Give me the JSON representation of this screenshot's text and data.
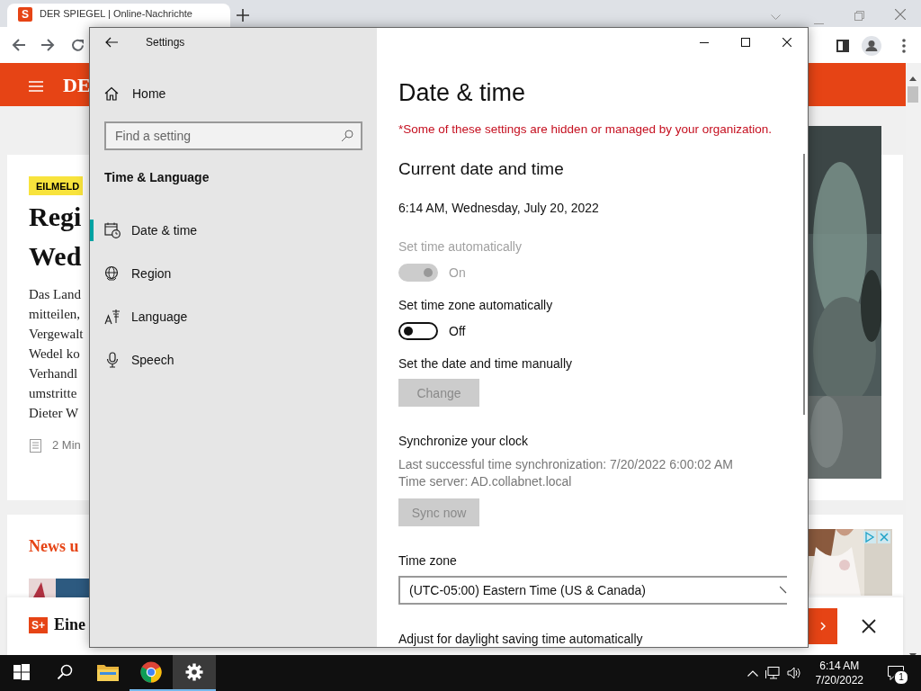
{
  "browser": {
    "tab": {
      "icon_text": "S",
      "title": "DER SPIEGEL | Online-Nachrichte"
    },
    "logo": "DE",
    "article": {
      "badge": "EILMELD",
      "headline": [
        "Regi",
        "Wed"
      ],
      "body": [
        "Das Land",
        "mitteilen,",
        "Vergewalt",
        "Wedel ko",
        "Verhandl",
        "umstritte",
        "Dieter W"
      ],
      "read_time": "2 Min"
    },
    "section_title": "News u",
    "banner": {
      "badge": "S+",
      "text": "Eine"
    }
  },
  "settings": {
    "title": "Settings",
    "home": "Home",
    "search": {
      "placeholder": "Find a setting"
    },
    "category": "Time & Language",
    "nav_items": [
      {
        "label": "Date & time",
        "selected": true
      },
      {
        "label": "Region",
        "selected": false
      },
      {
        "label": "Language",
        "selected": false
      },
      {
        "label": "Speech",
        "selected": false
      }
    ],
    "page": {
      "title": "Date & time",
      "notice": "*Some of these settings are hidden or managed by your organization.",
      "section": "Current date and time",
      "current": "6:14 AM, Wednesday, July 20, 2022",
      "items": [
        {
          "kind": "toggle",
          "label": "Set time automatically",
          "on": true,
          "disabled": true,
          "state_text": "On"
        },
        {
          "kind": "toggle",
          "label": "Set time zone automatically",
          "on": false,
          "disabled": false,
          "state_text": "Off"
        },
        {
          "kind": "button",
          "label": "Set the date and time manually",
          "button": "Change",
          "disabled": true
        },
        {
          "kind": "button",
          "label": "Synchronize your clock",
          "details": [
            "Last successful time synchronization: 7/20/2022 6:00:02 AM",
            "Time server: AD.collabnet.local"
          ],
          "button": "Sync now",
          "disabled": true
        },
        {
          "kind": "dropdown",
          "label": "Time zone",
          "value": "(UTC-05:00) Eastern Time (US & Canada)"
        },
        {
          "kind": "heading",
          "label": "Adjust for daylight saving time automatically"
        }
      ]
    }
  },
  "taskbar": {
    "apps": [
      {
        "kind": "start"
      },
      {
        "kind": "search"
      },
      {
        "kind": "explorer",
        "running": false,
        "selected": false
      },
      {
        "kind": "chrome",
        "running": true,
        "selected": false
      },
      {
        "kind": "settings",
        "running": true,
        "selected": true
      }
    ],
    "clock": {
      "time": "6:14 AM",
      "date": "7/20/2022"
    },
    "notifications": "1"
  }
}
